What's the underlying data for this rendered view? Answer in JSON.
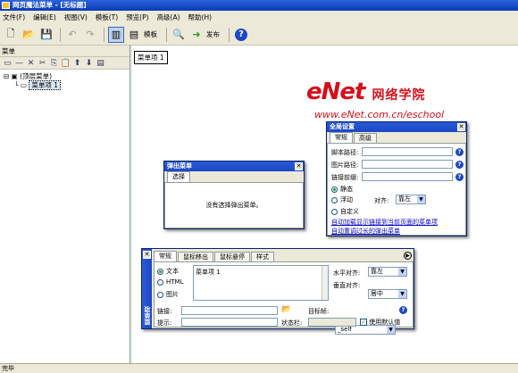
{
  "window": {
    "title": "网页魔法菜单 - [无标题]"
  },
  "menu": [
    "文件(F)",
    "编辑(E)",
    "视图(V)",
    "模板(T)",
    "预览(P)",
    "高级(A)",
    "帮助(H)"
  ],
  "toolbar": {
    "template_label": "模板",
    "publish_label": "发布"
  },
  "left_panel": {
    "title": "菜单",
    "tree": {
      "root": "(顶层菜单)",
      "item": "菜单项 1"
    }
  },
  "canvas": {
    "menu_tag": "菜单项 1"
  },
  "watermark": {
    "brand": "eNet",
    "brand_cn": "网络学院",
    "url": "www.eNet.com.cn/eschool"
  },
  "global_settings": {
    "title": "全局设置",
    "tabs": [
      "常规",
      "高级"
    ],
    "script_path_label": "脚本路径:",
    "image_path_label": "图片路径:",
    "link_prefix_label": "链接前缀:",
    "static_label": "静态",
    "float_label": "浮动",
    "align_label": "对齐:",
    "align_value": "靠左",
    "custom_label": "自定义",
    "link1": "自动加载显示链接到当前页面的菜单项",
    "link2": "自动重调过长的弹出菜单"
  },
  "popup_menu": {
    "title": "弹出菜单",
    "tab": "选择",
    "message": "没有选择弹出菜单。"
  },
  "item_props": {
    "side_label": "菜单项",
    "tabs": [
      "常规",
      "鼠标移出",
      "鼠标悬停",
      "样式"
    ],
    "text_option": "文本",
    "html_option": "HTML",
    "image_option": "图片",
    "text_value": "菜单项 1",
    "halign_label": "水平对齐:",
    "halign_value": "靠左",
    "valign_label": "垂直对齐:",
    "valign_value": "居中",
    "link_label": "链接:",
    "target_label": "目标帧:",
    "target_value": "_self",
    "tooltip_label": "提示:",
    "status_label": "状态栏:",
    "default_label": "使用默认值"
  },
  "status_bar": {
    "text": "完毕"
  }
}
